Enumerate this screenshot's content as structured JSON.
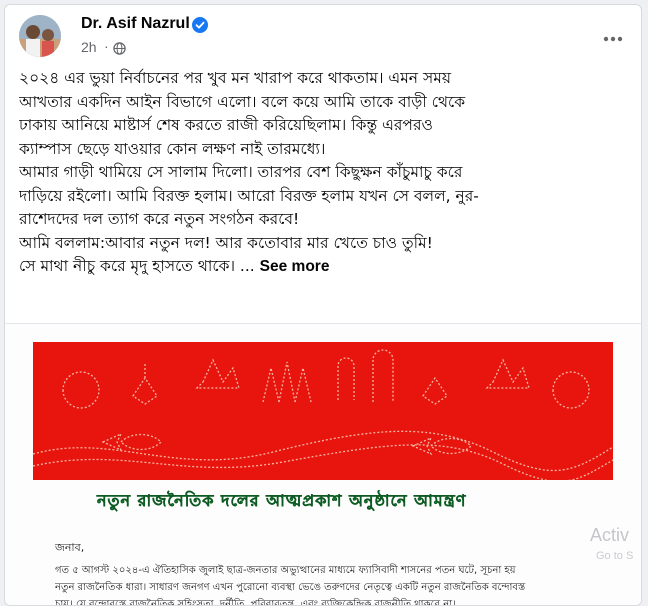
{
  "post": {
    "author": "Dr. Asif Nazrul",
    "timestamp": "2h",
    "separator": "·",
    "privacy_icon": "globe-icon",
    "verified_icon": "verified-badge-icon",
    "more_icon": "more-options-icon",
    "text_lines": [
      "২০২৪ এর ভুয়া নির্বাচনের পর খুব মন খারাপ করে থাকতাম। এমন সময়",
      "আখতার একদিন আইন বিভাগে এলো। বলে কয়ে আমি তাকে বাড়ী থেকে",
      "ঢাকায় আনিয়ে মাষ্টার্স শেষ করতে রাজী করিয়েছিলাম। কিন্তু এরপরও",
      "ক্যাম্পাস ছেড়ে যাওয়ার কোন লক্ষণ নাই তারমধ্যে।",
      "আমার গাড়ী থামিয়ে সে সালাম দিলো। তারপর বেশ কিছুক্ষন কাঁচুমাচু করে",
      "দাড়িয়ে রইলো।  আমি বিরক্ত হলাম। আরো বিরক্ত হলাম যখন সে বলল, নুর-",
      "রাশেদদের দল ত্যাগ করে নতুন সংগঠন করবে!",
      "আমি বললাম:আবার নতুন দল! আর কতোবার মার খেতে চাও তুমি!"
    ],
    "last_line": "সে মাথা নীচু করে মৃদু হাসতে থাকে। ...",
    "see_more": "See more"
  },
  "image": {
    "invite_title": "নতুন রাজনৈতিক দলের আত্মপ্রকাশ অনুষ্ঠানে আমন্ত্রণ",
    "salutation": "জনাব,",
    "body_lines": [
      "গত ৫ আগস্ট ২০২৪-এ ঐতিহাসিক জুলাই ছাত্র-জনতার অভ্যুত্থানের মাধ্যমে ফ্যাসিবাদী শাসনের পতন ঘটে, সূচনা হয়",
      "নতুন রাজনৈতিক ধারা। সাধারণ জনগণ এখন পুরোনো ব্যবস্থা ভেঙে তরুণদের নেতৃত্বে একটি নতুন রাজনৈতিক বন্দোবস্ত",
      "চায়। যে বন্দোবস্তে রাজনৈতিক সহিংসতা, দুর্নীতি, পরিবারতন্ত্র, এবং ব্যক্তিকেন্দ্রিক রাজনীতি থাকবে না।"
    ]
  },
  "system": {
    "watermark": "Activ",
    "watermark_sub": "Go to S"
  },
  "colors": {
    "banner_red": "#e8140e",
    "title_green": "#1a8a3a",
    "verified_blue": "#1877f2"
  }
}
